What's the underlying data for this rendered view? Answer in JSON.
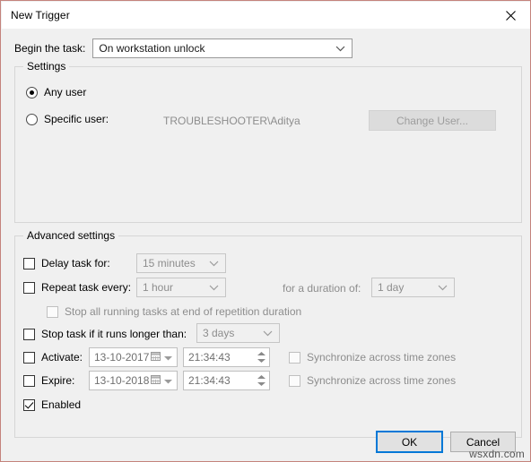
{
  "window": {
    "title": "New Trigger",
    "close_icon": "close-icon",
    "border_color": "#c4837c"
  },
  "begin": {
    "label": "Begin the task:",
    "value": "On workstation unlock",
    "chevron_icon": "chevron-down-icon"
  },
  "settings": {
    "group_label": "Settings",
    "any_user": {
      "label": "Any user",
      "checked": true
    },
    "specific_user": {
      "label": "Specific user:",
      "checked": false,
      "value": "TROUBLESHOOTER\\Aditya"
    },
    "change_user_button": "Change User..."
  },
  "advanced": {
    "group_label": "Advanced settings",
    "delay_task": {
      "label": "Delay task for:",
      "value": "15 minutes",
      "checked": false
    },
    "repeat_task": {
      "label": "Repeat task every:",
      "value": "1 hour",
      "checked": false
    },
    "duration": {
      "label": "for a duration of:",
      "value": "1 day"
    },
    "stop_all_running": {
      "label": "Stop all running tasks at end of repetition duration",
      "checked": false
    },
    "stop_task_longer": {
      "label": "Stop task if it runs longer than:",
      "value": "3 days",
      "checked": false
    },
    "activate": {
      "label": "Activate:",
      "date": "13-10-2017",
      "time": "21:34:43",
      "checked": false,
      "sync_label": "Synchronize across time zones",
      "sync_checked": false
    },
    "expire": {
      "label": "Expire:",
      "date": "13-10-2018",
      "time": "21:34:43",
      "checked": false,
      "sync_label": "Synchronize across time zones",
      "sync_checked": false
    },
    "enabled": {
      "label": "Enabled",
      "checked": true
    }
  },
  "footer": {
    "ok_label": "OK",
    "cancel_label": "Cancel",
    "accent_color": "#0078d7"
  },
  "watermark": "wsxdn.com"
}
